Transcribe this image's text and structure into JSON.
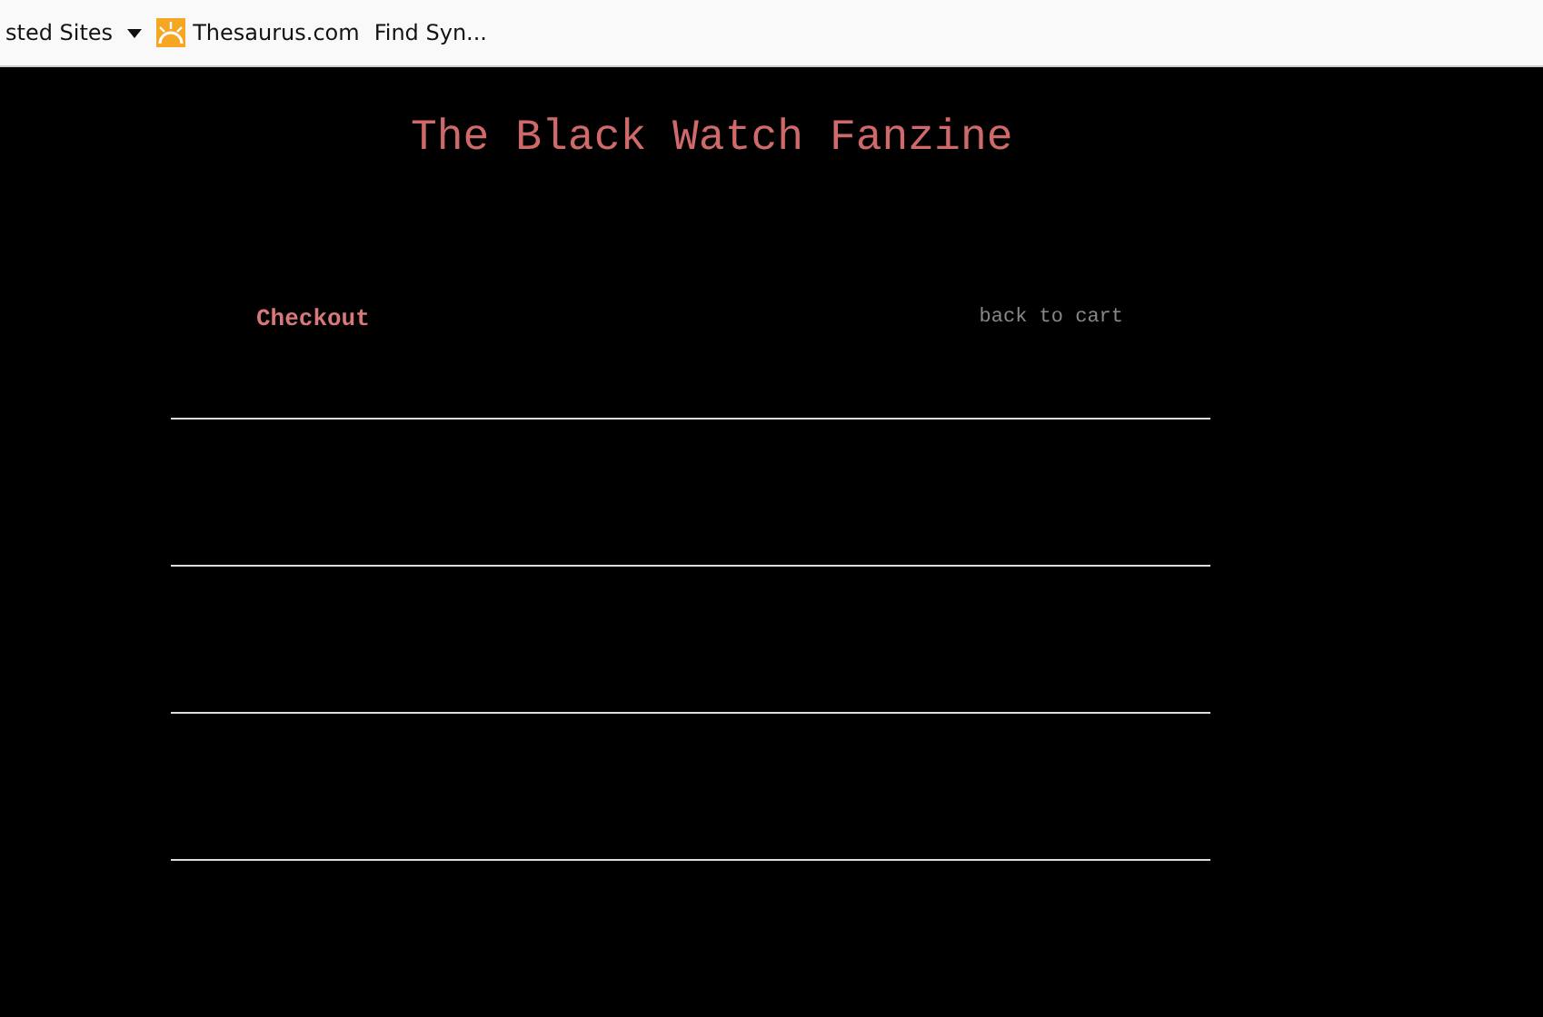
{
  "bookmarks_bar": {
    "items": [
      {
        "kind": "folder",
        "label": "sted Sites"
      },
      {
        "kind": "site",
        "label": "Thesaurus.com"
      },
      {
        "kind": "link",
        "label": "Find Syn..."
      }
    ]
  },
  "page": {
    "title": "The Black Watch Fanzine",
    "heading": "Checkout",
    "back_link": "back to cart"
  }
}
